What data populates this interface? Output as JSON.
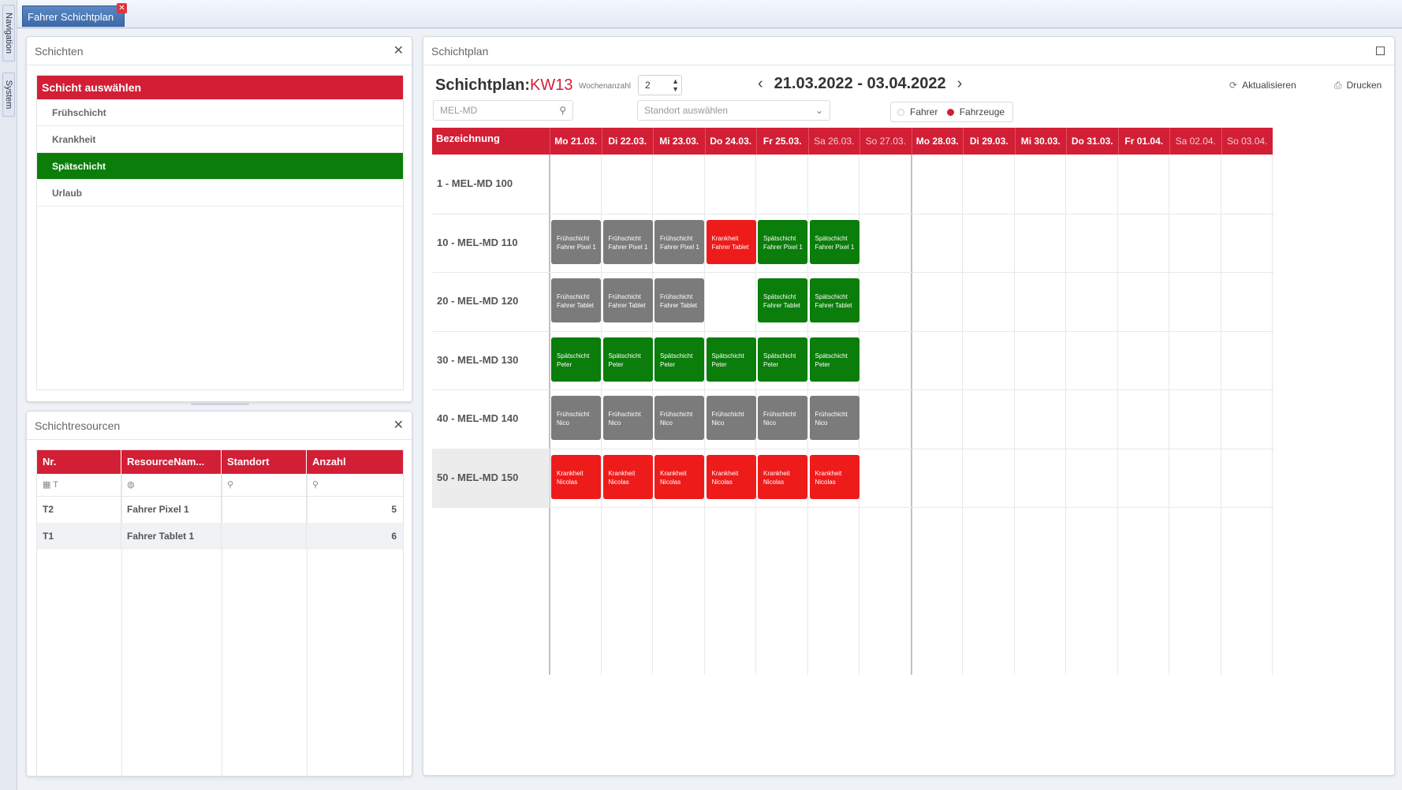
{
  "colors": {
    "accent": "#d21f36",
    "spaet": "#0a7d0a",
    "frueh": "#7b7b7b",
    "krank": "#ee1b1b"
  },
  "side_tabs": [
    "Navigation",
    "System"
  ],
  "doc_tab": {
    "label": "Fahrer Schichtplan"
  },
  "schichten_panel": {
    "title": "Schichten",
    "list_title": "Schicht auswählen",
    "items": [
      "Frühschicht",
      "Krankheit",
      "Spätschicht",
      "Urlaub"
    ],
    "selected": "Spätschicht"
  },
  "resources_panel": {
    "title": "Schichtresourcen",
    "columns": [
      "Nr.",
      "ResourceNam...",
      "Standort",
      "Anzahl"
    ],
    "filter_nr": "T",
    "rows": [
      {
        "nr": "T2",
        "name": "Fahrer Pixel 1",
        "standort": "",
        "anzahl": "5"
      },
      {
        "nr": "T1",
        "name": "Fahrer Tablet 1",
        "standort": "",
        "anzahl": "6"
      }
    ]
  },
  "plan_panel": {
    "title": "Schichtplan",
    "heading": "Schichtplan:",
    "kw": "KW13",
    "wochenanzahl_label": "Wochenanzahl",
    "wochenanzahl": "2",
    "date_range": "21.03.2022 - 03.04.2022",
    "refresh_label": "Aktualisieren",
    "print_label": "Drucken",
    "search_value": "MEL-MD",
    "standort_placeholder": "Standort auswählen",
    "toggle": [
      "Fahrer",
      "Fahrzeuge"
    ],
    "toggle_selected": "Fahrzeuge",
    "bez_header": "Bezeichnung",
    "days": [
      "Mo 21.03.",
      "Di 22.03.",
      "Mi 23.03.",
      "Do 24.03.",
      "Fr 25.03.",
      "Sa 26.03.",
      "So 27.03.",
      "Mo 28.03.",
      "Di 29.03.",
      "Mi 30.03.",
      "Do 31.03.",
      "Fr 01.04.",
      "Sa 02.04.",
      "So 03.04."
    ],
    "rows": [
      {
        "label": "1 - MEL-MD 100",
        "shifts": []
      },
      {
        "label": "10 - MEL-MD 110",
        "shifts": [
          {
            "day": 0,
            "type": "frueh",
            "line1": "Frühschicht",
            "line2": "Fahrer Pixel 1"
          },
          {
            "day": 1,
            "type": "frueh",
            "line1": "Frühschicht",
            "line2": "Fahrer Pixel 1"
          },
          {
            "day": 2,
            "type": "frueh",
            "line1": "Frühschicht",
            "line2": "Fahrer Pixel 1"
          },
          {
            "day": 3,
            "type": "krank",
            "line1": "Krankheit",
            "line2": "Fahrer Tablet"
          },
          {
            "day": 4,
            "type": "spaet",
            "line1": "Spätschicht",
            "line2": "Fahrer Pixel 1"
          },
          {
            "day": 5,
            "type": "spaet",
            "line1": "Spätschicht",
            "line2": "Fahrer Pixel 1"
          }
        ]
      },
      {
        "label": "20 - MEL-MD 120",
        "shifts": [
          {
            "day": 0,
            "type": "frueh",
            "line1": "Frühschicht",
            "line2": "Fahrer Tablet"
          },
          {
            "day": 1,
            "type": "frueh",
            "line1": "Frühschicht",
            "line2": "Fahrer Tablet"
          },
          {
            "day": 2,
            "type": "frueh",
            "line1": "Frühschicht",
            "line2": "Fahrer Tablet"
          },
          {
            "day": 4,
            "type": "spaet",
            "line1": "Spätschicht",
            "line2": "Fahrer Tablet"
          },
          {
            "day": 5,
            "type": "spaet",
            "line1": "Spätschicht",
            "line2": "Fahrer Tablet"
          }
        ]
      },
      {
        "label": "30 - MEL-MD 130",
        "shifts": [
          {
            "day": 0,
            "type": "spaet",
            "line1": "Spätschicht",
            "line2": "Peter"
          },
          {
            "day": 1,
            "type": "spaet",
            "line1": "Spätschicht",
            "line2": "Peter"
          },
          {
            "day": 2,
            "type": "spaet",
            "line1": "Spätschicht",
            "line2": "Peter"
          },
          {
            "day": 3,
            "type": "spaet",
            "line1": "Spätschicht",
            "line2": "Peter"
          },
          {
            "day": 4,
            "type": "spaet",
            "line1": "Spätschicht",
            "line2": "Peter"
          },
          {
            "day": 5,
            "type": "spaet",
            "line1": "Spätschicht",
            "line2": "Peter"
          }
        ]
      },
      {
        "label": "40 - MEL-MD 140",
        "shifts": [
          {
            "day": 0,
            "type": "frueh",
            "line1": "Frühschicht",
            "line2": "Nico"
          },
          {
            "day": 1,
            "type": "frueh",
            "line1": "Frühschicht",
            "line2": "Nico"
          },
          {
            "day": 2,
            "type": "frueh",
            "line1": "Frühschicht",
            "line2": "Nico"
          },
          {
            "day": 3,
            "type": "frueh",
            "line1": "Frühschicht",
            "line2": "Nico"
          },
          {
            "day": 4,
            "type": "frueh",
            "line1": "Frühschicht",
            "line2": "Nico"
          },
          {
            "day": 5,
            "type": "frueh",
            "line1": "Frühschicht",
            "line2": "Nico"
          }
        ]
      },
      {
        "label": "50 - MEL-MD 150",
        "shifts": [
          {
            "day": 0,
            "type": "krank",
            "line1": "Krankheit",
            "line2": "Nicolas"
          },
          {
            "day": 1,
            "type": "krank",
            "line1": "Krankheit",
            "line2": "Nicolas"
          },
          {
            "day": 2,
            "type": "krank",
            "line1": "Krankheit",
            "line2": "Nicolas"
          },
          {
            "day": 3,
            "type": "krank",
            "line1": "Krankheit",
            "line2": "Nicolas"
          },
          {
            "day": 4,
            "type": "krank",
            "line1": "Krankheit",
            "line2": "Nicolas"
          },
          {
            "day": 5,
            "type": "krank",
            "line1": "Krankheit",
            "line2": "Nicolas"
          }
        ]
      }
    ]
  }
}
